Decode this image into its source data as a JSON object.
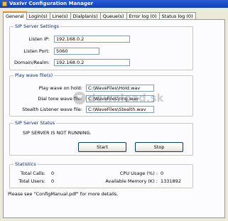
{
  "window": {
    "title": "VaxIvr Configuration Manager"
  },
  "tabs": [
    "General",
    "Login(s)",
    "Line(s)",
    "Dialplan(s)",
    "Queue(s)",
    "Error log (0)",
    "Status log (0)"
  ],
  "sip_settings": {
    "title": "SIP Server Settings",
    "listen_ip_label": "Listen IP:",
    "listen_ip_value": "192.168.0.2",
    "listen_port_label": "Listen Port:",
    "listen_port_value": "5060",
    "domain_label": "Domain/Realm:",
    "domain_value": "192.168.0.2"
  },
  "wave_files": {
    "title": "Play wave file(s)",
    "hold_label": "Play wave on hold:",
    "hold_value": "C:\\WaveFiles\\Hold.wav",
    "dial_label": "Dial tone wave file:",
    "dial_value": "C:\\WaveFiles\\ring.wav",
    "stealth_label": "Stealth Listener wave file:",
    "stealth_value": "C:\\WaveFiles\\Stealth.wav"
  },
  "server_status": {
    "title": "SIP Server Status",
    "message": "SIP SERVER IS NOT RUNNING.",
    "start_label": "Start",
    "stop_label": "Stop"
  },
  "statistics": {
    "title": "Statistics",
    "total_calls_label": "Total Calls:",
    "total_calls_value": "0",
    "total_users_label": "Total Users:",
    "total_users_value": "0",
    "cpu_label": "CPU Usage (%) :",
    "cpu_value": "0",
    "memory_label": "Available Memory (K) :",
    "memory_value": "1331892"
  },
  "footer": "Please see \"ConfigManual.pdf\" for more details.",
  "watermark": "download.sk"
}
